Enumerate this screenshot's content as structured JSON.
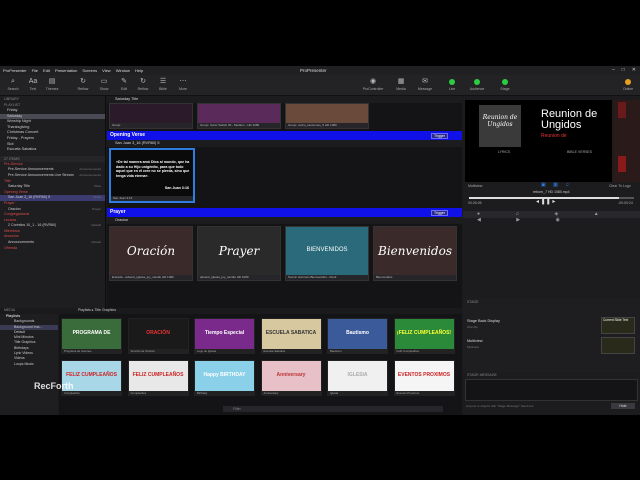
{
  "app": {
    "title": "ProPresenter",
    "menu": [
      "ProPresenter",
      "File",
      "Edit",
      "Presentation",
      "Screens",
      "View",
      "Window",
      "Help"
    ]
  },
  "toolbar": {
    "left": [
      {
        "icon": "search-icon",
        "label": "Search"
      },
      {
        "icon": "text-icon",
        "label": "Text"
      },
      {
        "icon": "themes-icon",
        "label": "Themes"
      },
      {
        "icon": "reflow-icon",
        "label": "Reflow"
      },
      {
        "icon": "show-icon",
        "label": "Show"
      },
      {
        "icon": "edit-icon",
        "label": "Edit"
      },
      {
        "icon": "reflow-icon",
        "label": "Reflow"
      },
      {
        "icon": "bible-icon",
        "label": "Bible"
      },
      {
        "icon": "more-icon",
        "label": "More"
      }
    ],
    "right": [
      {
        "icon": "procontrol-icon",
        "label": "ProController"
      },
      {
        "icon": "media-icon",
        "label": "Media"
      },
      {
        "icon": "message-icon",
        "label": "Message"
      },
      {
        "icon": "live-icon",
        "label": "Live"
      },
      {
        "icon": "audience-icon",
        "label": "Audience"
      },
      {
        "icon": "stage-icon",
        "label": "Stage"
      },
      {
        "icon": "avatar-icon",
        "label": "Online"
      }
    ]
  },
  "library": {
    "header_library": "LIBRARY",
    "header_playlist": "PLAYLIST",
    "playlists": [
      "Friday",
      "Saturday",
      "Worship Night",
      "Thanksgiving",
      "Christmas Concert",
      "Friday - Prayers",
      "Slot",
      "Escuela Sabatica"
    ],
    "items_header": "27 ITEMS",
    "items": [
      {
        "name": "Pre-Service",
        "tag": "",
        "header": true
      },
      {
        "name": "Pre-Service Announcements",
        "tag": "Announcements"
      },
      {
        "name": "Pre-Service Announcements Live Stream",
        "tag": "Announcements"
      },
      {
        "name": "Title",
        "tag": "",
        "header": true
      },
      {
        "name": "Saturday Title",
        "tag": "Titles"
      },
      {
        "name": "Opening Verse",
        "tag": "",
        "header": true
      },
      {
        "name": "San Juan 3_16 (RVR60) 5",
        "tag": "Verse",
        "sel": true
      },
      {
        "name": "Prayer",
        "tag": "",
        "header": true
      },
      {
        "name": "Oracion",
        "tag": "Prayer"
      },
      {
        "name": "Congregacional",
        "tag": "",
        "header": true
      },
      {
        "name": "Lectura",
        "tag": "",
        "header": true
      },
      {
        "name": "2 Corintios 10_1 - 16 (RVR60)",
        "tag": "Default"
      },
      {
        "name": "Miembros",
        "tag": "",
        "header": true
      },
      {
        "name": "Anuncios",
        "tag": "",
        "header": true
      },
      {
        "name": "Announcements",
        "tag": "Default"
      },
      {
        "name": "Ofrenda",
        "tag": "",
        "header": true
      }
    ]
  },
  "center": {
    "top_pres": "Saturday Title",
    "top_captions": [
      "Group",
      "Group: Sonic Switch 00 - Medium - HD 1080",
      "Group: verbo_canciones_5 HD 1080"
    ],
    "opening_group": "Opening Verse",
    "trigger": "Trigger",
    "verse_pres": "San Juan 3_16 (RVR60) 5",
    "verse_text": "«De tal manera amó Dios al mundo, que ha dado a su Hijo unigénito, para que todo aquel que en él cree no se pierda, sino que tenga vida eterna».",
    "verse_ref": "San Juan 3:16",
    "verse_caption": "San Juan 3:16",
    "prayer_group": "Prayer",
    "prayer_pres": "Oracion",
    "prayer_slides": [
      {
        "title": "Oración",
        "caption": "Entrada - adventi_iglesia_joy_candle HD 1080"
      },
      {
        "title": "Prayer",
        "caption": "adventi_iglesia_joy_candle HD 1080"
      },
      {
        "title": "BIENVENIDOS",
        "caption": "Scenic Horizons Bienvenidos - Rock"
      },
      {
        "title": "Bienvenidos",
        "caption": "Bienvenidos"
      }
    ],
    "bottom_bar": {
      "zoom_label": "0.0x",
      "verse_label": "Verse"
    }
  },
  "media": {
    "header": "MEDIA",
    "breadcrumb": [
      "Playlists",
      "Title Graphics"
    ],
    "sidebar": [
      {
        "name": "Playlists",
        "header": true
      },
      {
        "name": "Backgrounds"
      },
      {
        "name": "Background Ima...",
        "sel": true
      },
      {
        "name": "Default"
      },
      {
        "name": "Mini Minutos"
      },
      {
        "name": "Title Graphics"
      },
      {
        "name": "Birthdays"
      },
      {
        "name": "Lyric Videos"
      },
      {
        "name": "Videos"
      },
      {
        "name": "Loops Music"
      }
    ],
    "filter_placeholder": "Filter",
    "thumbs": [
      {
        "title": "PROGRAMA DE",
        "caption": "Programa de Jovenes",
        "bg": "#3a6b3a",
        "color": "#fff"
      },
      {
        "title": "ORACIÓN",
        "caption": "Servicio de Oracion",
        "bg": "#1a1a1a",
        "color": "#e33"
      },
      {
        "title": "Tiempo Especial",
        "caption": "Logo de Iglesia",
        "bg": "#7a2a8a",
        "color": "#fff"
      },
      {
        "title": "ESCUELA SABATICA",
        "caption": "Escuela Sabatica",
        "bg": "#d8c8a0",
        "color": "#333"
      },
      {
        "title": "Bautismo",
        "caption": "Bautismo",
        "bg": "#3a5a9a",
        "color": "#fff"
      },
      {
        "title": "¡FELIZ CUMPLEAÑOS!",
        "caption": "Feliz Cumpleaños",
        "bg": "#2a8a3a",
        "color": "#ff3"
      },
      {
        "title": "FELIZ CUMPLEAÑOS",
        "caption": "Cumpleaños",
        "bg": "#a8d8e8",
        "color": "#c22"
      },
      {
        "title": "FELIZ CUMPLEAÑOS",
        "caption": "Cumpleaños",
        "bg": "#e8e8e8",
        "color": "#c22"
      },
      {
        "title": "Happy BIRTHDAY",
        "caption": "Birthday",
        "bg": "#8ad0e8",
        "color": "#fff"
      },
      {
        "title": "Anniversary",
        "caption": "Anniversary",
        "bg": "#e8c0c8",
        "color": "#b33"
      },
      {
        "title": "IGLESIA",
        "caption": "Iglesia",
        "bg": "#f0f0f0",
        "color": "#aaa"
      },
      {
        "title": "EVENTOS PROXIMOS",
        "caption": "Eventos Proximos",
        "bg": "#f5f5f5",
        "color": "#c22"
      }
    ]
  },
  "right": {
    "preview_title": "Reunion de Ungidos",
    "preview_sub": "Reunion de",
    "lyrics_label": "LYRICS",
    "bible_label": "BIBLE VERSES",
    "multiview": "Multiview",
    "clear_label": "Clear To Logo",
    "file_name": "reborn_7 HD 1080.mp4",
    "time_elapsed": "00:26:06",
    "time_remaining": "-00:00:24",
    "stage_header": "STAGE",
    "stage_rows": [
      {
        "name": "Stage Back Display",
        "sub": "Worship",
        "layout": "Current Slide Text"
      },
      {
        "name": "Multiview",
        "sub": "Multiview",
        "layout": ""
      }
    ],
    "stage_msg_header": "STAGE MESSAGE",
    "stage_msg_hint": "Anyone or objects with \"Stage Message\" Send text",
    "hide_button": "Hide"
  },
  "watermark": "RecForth"
}
